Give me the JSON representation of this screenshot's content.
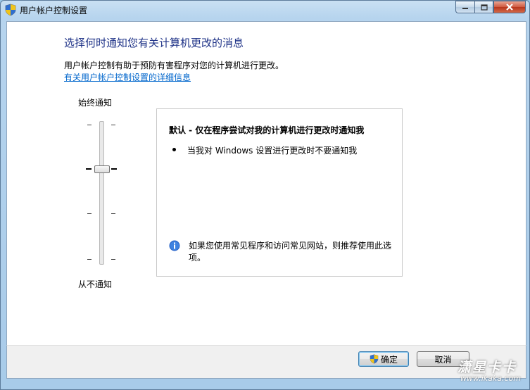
{
  "window": {
    "title": "用户帐户控制设置"
  },
  "header": {
    "heading": "选择何时通知您有关计算机更改的消息",
    "description": "用户帐户控制有助于预防有害程序对您的计算机进行更改。",
    "link": "有关用户帐户控制设置的详细信息"
  },
  "slider": {
    "top_label": "始终通知",
    "bottom_label": "从不通知",
    "levels": 4,
    "selected_level": 3
  },
  "panel": {
    "title": "默认 - 仅在程序尝试对我的计算机进行更改时通知我",
    "bullets": [
      "当我对 Windows 设置进行更改时不要通知我"
    ],
    "info": "如果您使用常见程序和访问常见网站，则推荐使用此选项。"
  },
  "buttons": {
    "ok": "确定",
    "cancel": "取消"
  },
  "watermark": {
    "brand": "潇星卡卡",
    "url": "www.ikaka.com"
  },
  "colors": {
    "heading": "#1e3287",
    "link": "#0066cc"
  },
  "icons": {
    "title": "uac-shield-icon",
    "ok_button": "uac-shield-icon",
    "info": "info-icon"
  }
}
